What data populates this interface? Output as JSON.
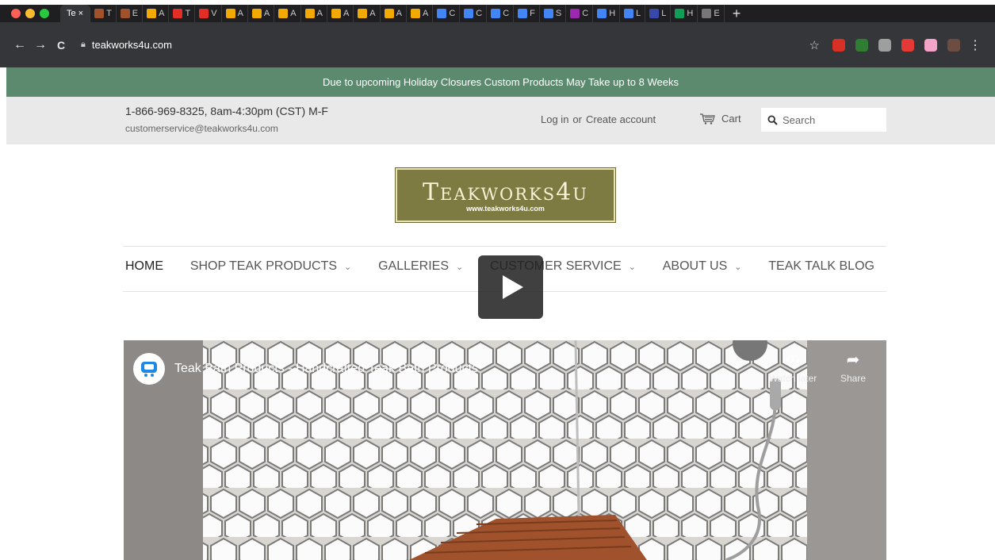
{
  "browser": {
    "traffic_colors": [
      "#fe5f57",
      "#febc2e",
      "#28c840"
    ],
    "active_tab": {
      "label": "Te",
      "close": "×"
    },
    "tabs": [
      {
        "label": "T",
        "color": "#a0522d"
      },
      {
        "label": "E",
        "color": "#a0522d"
      },
      {
        "label": "A",
        "color": "#f2a900"
      },
      {
        "label": "T",
        "color": "#e52d27"
      },
      {
        "label": "V",
        "color": "#e52d27"
      },
      {
        "label": "A",
        "color": "#f2a900"
      },
      {
        "label": "A",
        "color": "#f2a900"
      },
      {
        "label": "A",
        "color": "#f2a900"
      },
      {
        "label": "A",
        "color": "#f2a900"
      },
      {
        "label": "A",
        "color": "#f2a900"
      },
      {
        "label": "A",
        "color": "#f2a900"
      },
      {
        "label": "A",
        "color": "#f2a900"
      },
      {
        "label": "A",
        "color": "#f2a900"
      },
      {
        "label": "C",
        "color": "#4285f4"
      },
      {
        "label": "C",
        "color": "#4285f4"
      },
      {
        "label": "C",
        "color": "#4285f4"
      },
      {
        "label": "F",
        "color": "#4285f4"
      },
      {
        "label": "S",
        "color": "#4285f4"
      },
      {
        "label": "C",
        "color": "#9c27b0"
      },
      {
        "label": "H",
        "color": "#4285f4"
      },
      {
        "label": "L",
        "color": "#4285f4"
      },
      {
        "label": "L",
        "color": "#3949ab"
      },
      {
        "label": "H",
        "color": "#0f9d58"
      },
      {
        "label": "E",
        "color": "#777777"
      }
    ],
    "new_tab": "+",
    "nav": {
      "back": "←",
      "forward": "→",
      "reload": "C"
    },
    "url": "teakworks4u.com",
    "bookmark_star": "☆",
    "extension_colors": [
      "#d93025",
      "#2e7d32",
      "#9e9e9e",
      "#e53935",
      "#f4a3c8",
      "#6d4c41"
    ],
    "menu": "⋮"
  },
  "site": {
    "announcement": "Due to upcoming Holiday Closures Custom Products May Take up to 8 Weeks",
    "phone": "1-866-969-8325, 8am-4:30pm (CST) M-F",
    "email": "customerservice@teakworks4u.com",
    "login": "Log in",
    "or": "or",
    "create_account": "Create account",
    "cart": "Cart",
    "search_placeholder": "Search",
    "logo_name": "Teakworks4u",
    "logo_url": "www.teakworks4u.com",
    "nav": [
      {
        "label": "HOME"
      },
      {
        "label": "SHOP TEAK PRODUCTS"
      },
      {
        "label": "GALLERIES"
      },
      {
        "label": "CUSTOMER SERVICE"
      },
      {
        "label": "ABOUT US"
      },
      {
        "label": "TEAK TALK BLOG"
      }
    ],
    "video": {
      "title": "Teak Bath Products - Handcrafted Teak Bath Products",
      "watch_later": "Watch later",
      "share": "Share"
    }
  }
}
